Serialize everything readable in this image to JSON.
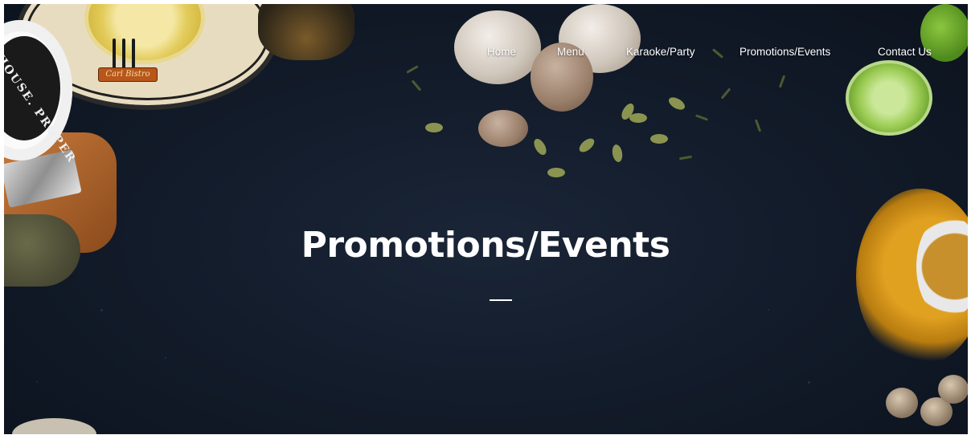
{
  "logo": {
    "text": "Carl Bistro"
  },
  "decor": {
    "jar_text": "HOUSE. PROPER"
  },
  "nav": {
    "items": [
      {
        "label": "Home"
      },
      {
        "label": "Menu"
      },
      {
        "label": "Karaoke/Party"
      },
      {
        "label": "Promotions/Events"
      },
      {
        "label": "Contact Us"
      }
    ]
  },
  "hero": {
    "title": "Promotions/Events"
  },
  "colors": {
    "background": "#131c2b",
    "text": "#ffffff",
    "logo_badge": "#b8561b"
  },
  "icons": [
    "logo-fork-icon",
    "logo-spoon-icon"
  ]
}
